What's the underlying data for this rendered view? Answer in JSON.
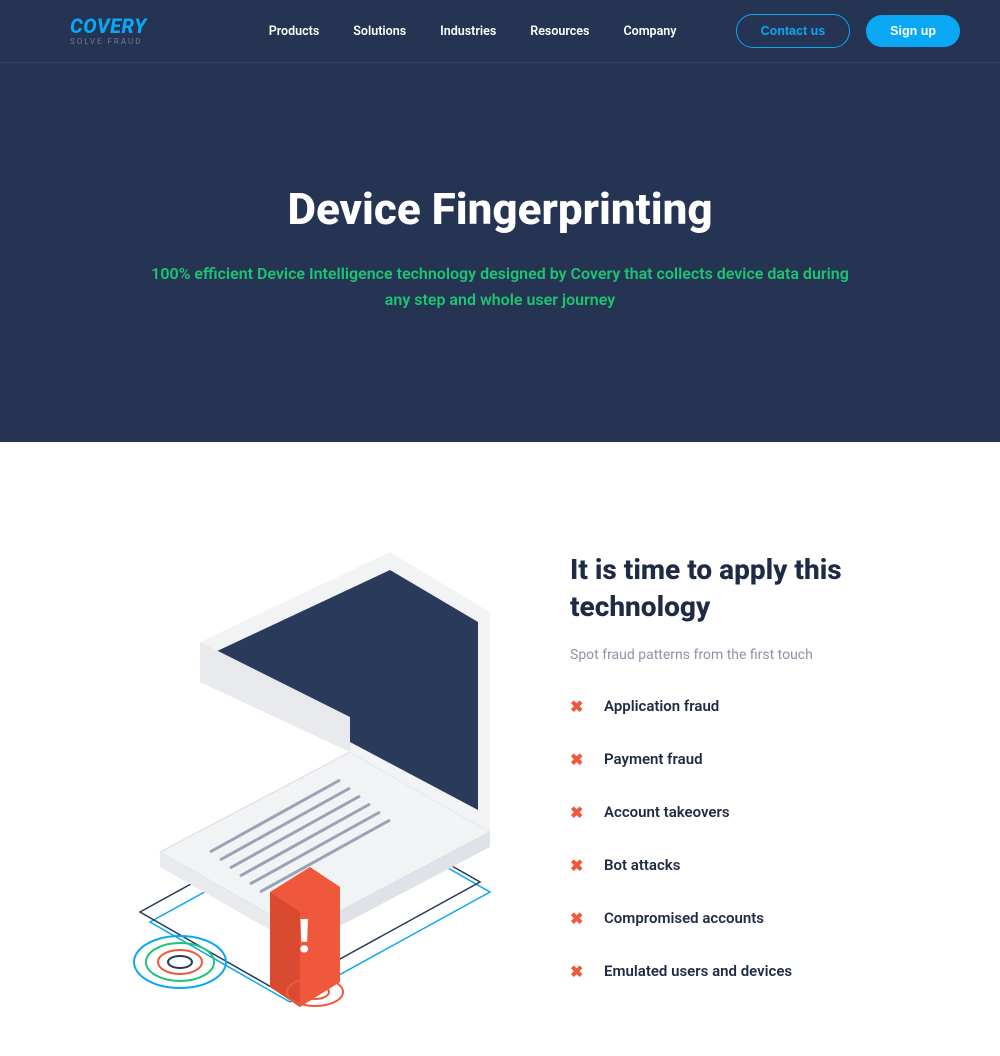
{
  "brand": {
    "name": "COVERY",
    "tagline": "SOLVE FRAUD"
  },
  "nav": {
    "items": [
      {
        "label": "Products"
      },
      {
        "label": "Solutions"
      },
      {
        "label": "Industries"
      },
      {
        "label": "Resources"
      },
      {
        "label": "Company"
      }
    ]
  },
  "header_cta": {
    "contact": "Contact us",
    "signup": "Sign up"
  },
  "hero": {
    "title": "Device Fingerprinting",
    "subtitle": "100% efficient Device Intelligence technology designed by Covery that collects device data during any step and whole user journey"
  },
  "section": {
    "heading": "It is time to apply this technology",
    "sub": "Spot fraud patterns from the first touch",
    "items": [
      {
        "label": "Application fraud"
      },
      {
        "label": "Payment fraud"
      },
      {
        "label": "Account takeovers"
      },
      {
        "label": "Bot attacks"
      },
      {
        "label": "Compromised accounts"
      },
      {
        "label": "Emulated users and devices"
      }
    ]
  }
}
